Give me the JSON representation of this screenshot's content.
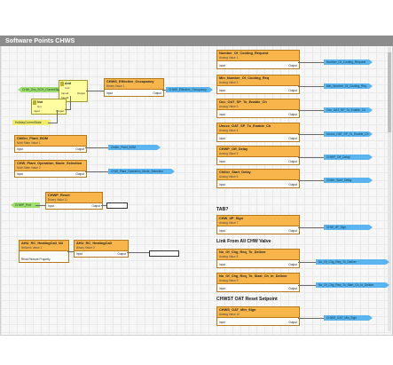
{
  "page": {
    "title": "Software Points CHWS"
  },
  "labels": {
    "input": "Input",
    "output": "Output"
  },
  "colors": {
    "block": "#f8b54b",
    "tag_blue": "#5ab4f0",
    "tag_green": "#9fde6c",
    "logic": "#fffda0",
    "header_bar": "#8c8c8c"
  },
  "logic_blocks": [
    {
      "name": "And",
      "sub": "And",
      "in1": "Input1",
      "in2": "Input2",
      "out": "Output"
    },
    {
      "name": "Not",
      "sub": "Not",
      "in": "Input",
      "out": "Output"
    }
  ],
  "left_blocks": [
    {
      "name": "CHWS_Effective_Occupancy",
      "sub": "Binary Value 1"
    },
    {
      "name": "Chiller_Plant_BOM",
      "sub": "Multi State Value 1"
    },
    {
      "name": "CHW_Plant_Operation_Mode_Selection",
      "sub": "Multi State Value 2"
    },
    {
      "name": "CHWP_Reset",
      "sub": "Binary Value 11"
    },
    {
      "name": "AHU_RC_HeatingCall_N4",
      "sub": "Network Value 1"
    },
    {
      "name": "AHU_RC_HeatingCall",
      "sub": "Binary Value 3"
    }
  ],
  "right_blocks": [
    {
      "name": "Number_Of_Cooling_Request",
      "sub": "Analog Value 1"
    },
    {
      "name": "Min_Number_Of_Cooling_Req",
      "sub": "Analog Value 2"
    },
    {
      "name": "Occ_OAT_SP_To_Enable_Ch",
      "sub": "Analog Value 3"
    },
    {
      "name": "Unocc_OAT_SP_To_Enable_Ch",
      "sub": "Analog Value 4"
    },
    {
      "name": "CHWP_Off_Delay",
      "sub": "Analog Value 5"
    },
    {
      "name": "Chiller_Start_Delay",
      "sub": "Analog Value 6"
    },
    {
      "name": "CHW_dP_Sign",
      "sub": "Analog Value 7"
    },
    {
      "name": "No_Of_Chg_Req_To_Deliver",
      "sub": "Analog Value 8"
    },
    {
      "name": "No_Of_Chg_Req_To_Start_Ch_In_Deliver",
      "sub": "Analog Value 9"
    },
    {
      "name": "CHWS_OAT_Min_Sign",
      "sub": "Analog Value 10"
    }
  ],
  "tags": {
    "in_occ": "CHW_Occ_SCH_CurrentState",
    "in_hold": "HolidayCurrentState",
    "occ_out": "CHWS_Effective_Occupancy",
    "bom_out": "Chiller_Plant_BOM",
    "mode_out": "CHW_Plant_Operation_Mode_Selection",
    "chwp_in": "CHWP_Prof",
    "heat_in": "Read Remote Property",
    "r1": "Number_Of_Cooling_Request",
    "r2": "Min_Number_Of_Cooling_Req",
    "r3": "Occ_OAT_SP_To_Enable_Ch",
    "r4": "Unocc_OAT_SP_To_Enable_Ch",
    "r5": "CHWP_Off_Delay",
    "r6": "Chiller_Start_Delay",
    "r7": "CHW_dP_Sign",
    "r8": "No_Of_Chg_Req_To_Deliver",
    "r9": "No_Of_Chg_Req_To_Start_Ch_In_Deliver",
    "r10": "CHWS_OAT_Min_Sign"
  },
  "sections": {
    "tab": "TAB?",
    "link": "Link From All CHW Valve",
    "reset": "CHWST OAT Reset Setpoint"
  }
}
